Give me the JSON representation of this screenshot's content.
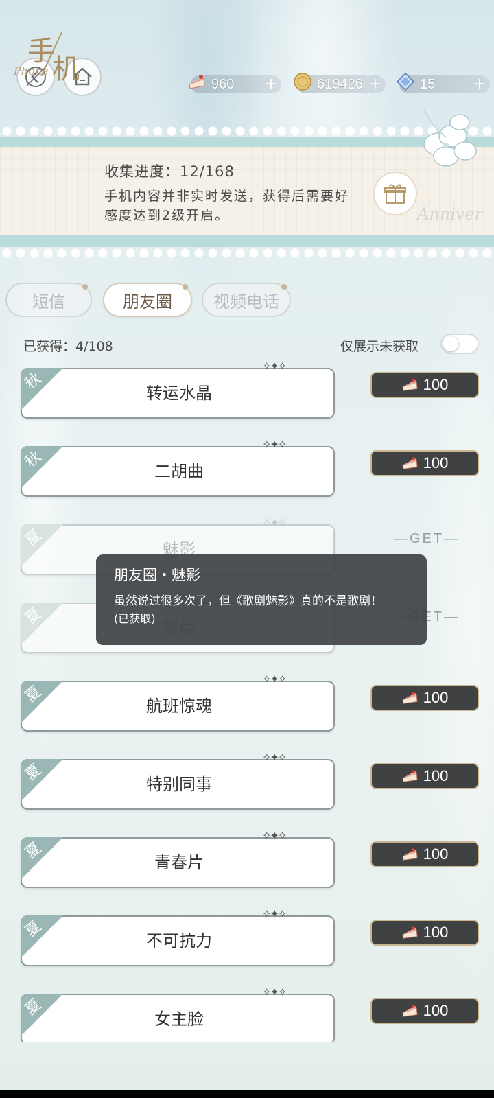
{
  "top_bar": {
    "back_icon": "back-arrow-icon",
    "home_icon": "home-icon",
    "resources": [
      {
        "name": "cake",
        "icon": "cake-icon",
        "value": "960",
        "plus": "+"
      },
      {
        "name": "coin",
        "icon": "coin-icon",
        "value": "619426",
        "plus": "+"
      },
      {
        "name": "gem",
        "icon": "diamond-icon",
        "value": "15",
        "plus": "+"
      }
    ]
  },
  "banner": {
    "logo_char1": "手",
    "logo_char2": "机",
    "logo_script": "Phone",
    "progress": "收集进度：12/168",
    "desc": "手机内容并非实时发送，获得后需要好感度达到2级开启。",
    "watermark": "Anniver"
  },
  "tabs": [
    {
      "label": "短信",
      "active": false
    },
    {
      "label": "朋友圈",
      "active": true
    },
    {
      "label": "视频电话",
      "active": false
    }
  ],
  "filter": {
    "obtained": "已获得：4/108",
    "only_unobtained": "仅展示未获取",
    "toggle_on": false
  },
  "items": [
    {
      "season": "秋",
      "title": "转运水晶",
      "obtained": false,
      "price": "100"
    },
    {
      "season": "秋",
      "title": "二胡曲",
      "obtained": false,
      "price": "100"
    },
    {
      "season": "夏",
      "title": "魅影",
      "obtained": true,
      "get": "—GET—"
    },
    {
      "season": "夏",
      "title": "智齿",
      "obtained": true,
      "get": "—GET—"
    },
    {
      "season": "夏",
      "title": "航班惊魂",
      "obtained": false,
      "price": "100"
    },
    {
      "season": "夏",
      "title": "特别同事",
      "obtained": false,
      "price": "100"
    },
    {
      "season": "夏",
      "title": "青春片",
      "obtained": false,
      "price": "100"
    },
    {
      "season": "夏",
      "title": "不可抗力",
      "obtained": false,
      "price": "100"
    },
    {
      "season": "夏",
      "title": "女主脸",
      "obtained": false,
      "price": "100"
    }
  ],
  "tooltip": {
    "title": "朋友圈・魅影",
    "text": "虽然说过很多次了，但《歌剧魅影》真的不是歌剧！",
    "status": "(已获取)"
  },
  "colors": {
    "accent_teal": "#9ab7b5",
    "button_dark": "#3f4142",
    "gold_border": "#c9b58f"
  }
}
